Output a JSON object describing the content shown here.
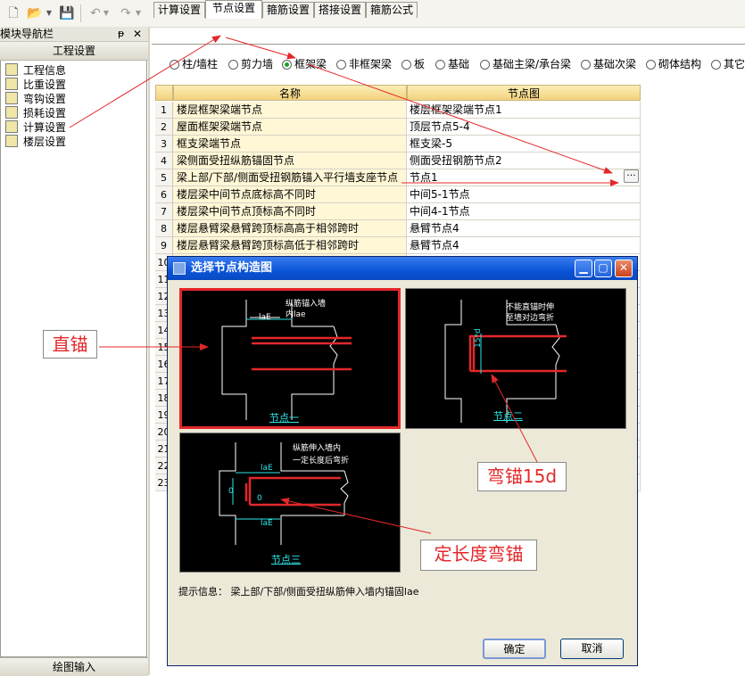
{
  "toolbar": {
    "icons": [
      "new-file-icon",
      "open-folder-icon",
      "dropdown-arrow-icon",
      "save-icon",
      "undo-icon",
      "redo-icon"
    ]
  },
  "nav": {
    "title": "模块导航栏",
    "pin": "ᵽ",
    "close": "✕",
    "header": "工程设置",
    "items": [
      {
        "label": "工程信息"
      },
      {
        "label": "比重设置"
      },
      {
        "label": "弯钩设置"
      },
      {
        "label": "损耗设置"
      },
      {
        "label": "计算设置"
      },
      {
        "label": "楼层设置"
      }
    ],
    "bottom": "绘图输入"
  },
  "tabs": [
    "计算设置",
    "节点设置",
    "箍筋设置",
    "搭接设置",
    "箍筋公式"
  ],
  "active_tab": "节点设置",
  "radios": [
    {
      "label": "柱/墙柱",
      "checked": false
    },
    {
      "label": "剪力墙",
      "checked": false
    },
    {
      "label": "框架梁",
      "checked": true
    },
    {
      "label": "非框架梁",
      "checked": false
    },
    {
      "label": "板",
      "checked": false
    },
    {
      "label": "基础",
      "checked": false
    },
    {
      "label": "基础主梁/承台梁",
      "checked": false
    },
    {
      "label": "基础次梁",
      "checked": false
    },
    {
      "label": "砌体结构",
      "checked": false
    },
    {
      "label": "其它",
      "checked": false
    }
  ],
  "table": {
    "headers": [
      "名称",
      "节点图"
    ],
    "rows": [
      {
        "num": "1",
        "name": "楼层框架梁端节点",
        "value": "楼层框架梁端节点1"
      },
      {
        "num": "2",
        "name": "屋面框架梁端节点",
        "value": "顶层节点5-4"
      },
      {
        "num": "3",
        "name": "框支梁端节点",
        "value": "框支梁-5"
      },
      {
        "num": "4",
        "name": "梁侧面受扭纵筋锚固节点",
        "value": "侧面受扭钢筋节点2"
      },
      {
        "num": "5",
        "name": "梁上部/下部/侧面受扭钢筋锚入平行墙支座节点",
        "value": "节点1"
      },
      {
        "num": "6",
        "name": "楼层梁中间节点底标高不同时",
        "value": "中间5-1节点"
      },
      {
        "num": "7",
        "name": "楼层梁中间节点顶标高不同时",
        "value": "中间4-1节点"
      },
      {
        "num": "8",
        "name": "楼层悬臂梁悬臂跨顶标高高于相邻跨时",
        "value": "悬臂节点4"
      },
      {
        "num": "9",
        "name": "楼层悬臂梁悬臂跨顶标高低于相邻跨时",
        "value": "悬臂节点4"
      },
      {
        "num": "10",
        "name": "",
        "value": ""
      },
      {
        "num": "11",
        "name": "",
        "value": ""
      },
      {
        "num": "12",
        "name": "",
        "value": ""
      },
      {
        "num": "13",
        "name": "",
        "value": ""
      },
      {
        "num": "14",
        "name": "",
        "value": ""
      },
      {
        "num": "15",
        "name": "",
        "value": ""
      },
      {
        "num": "16",
        "name": "",
        "value": ""
      },
      {
        "num": "17",
        "name": "",
        "value": ""
      },
      {
        "num": "18",
        "name": "",
        "value": ""
      },
      {
        "num": "19",
        "name": "",
        "value": ""
      },
      {
        "num": "20",
        "name": "",
        "value": ""
      },
      {
        "num": "21",
        "name": "",
        "value": ""
      },
      {
        "num": "22",
        "name": "",
        "value": ""
      },
      {
        "num": "23",
        "name": "",
        "value": ""
      }
    ],
    "ellipsis": "···"
  },
  "dialog": {
    "title": "选择节点构造图",
    "options": [
      {
        "label": "节点一",
        "selected": true,
        "texts": [
          "纵筋锚入墙",
          "内lae",
          "laE"
        ]
      },
      {
        "label": "节点二",
        "selected": false,
        "texts": [
          "不能直锚时伸",
          "至墙对边弯折",
          "15*d"
        ]
      },
      {
        "label": "节点三",
        "selected": false,
        "texts": [
          "纵筋伸入墙内",
          "一定长度后弯折",
          "laE",
          "laE",
          "0",
          "0"
        ]
      }
    ],
    "hint": "提示信息： 梁上部/下部/侧面受扭纵筋伸入墙内锚固lae",
    "ok": "确定",
    "cancel": "取消"
  },
  "annotations": {
    "straight": "直锚",
    "bent15d": "弯锚15d",
    "fixed_bent": "定长度弯锚"
  },
  "colors": {
    "annotation_red": "#e4272a",
    "dialog_blue": "#0a54d8",
    "header_yellow": "#f2d27e",
    "rebar_red": "#e4272a",
    "label_cyan": "#2de6e8"
  }
}
